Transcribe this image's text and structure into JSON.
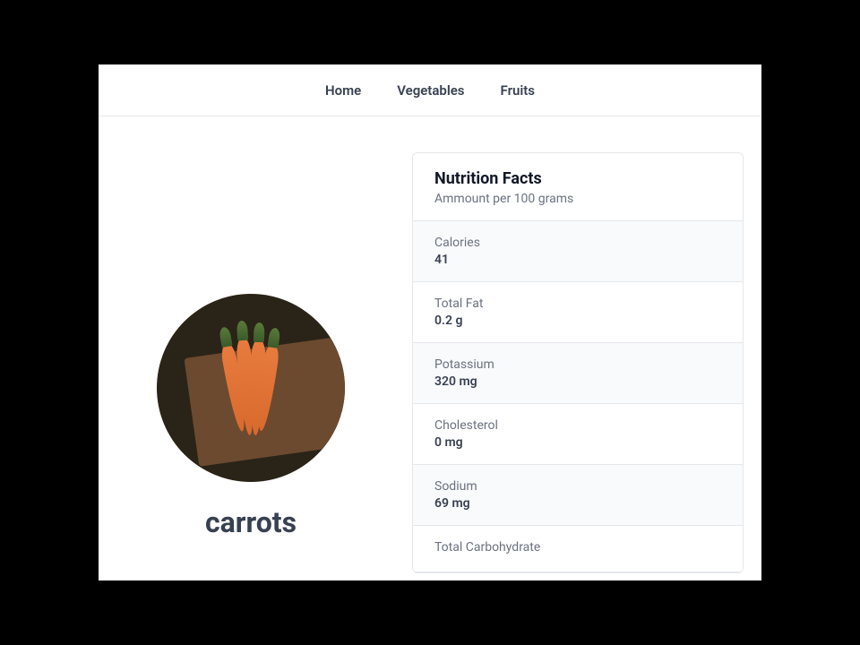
{
  "nav": {
    "home": "Home",
    "vegetables": "Vegetables",
    "fruits": "Fruits"
  },
  "food": {
    "name": "carrots"
  },
  "facts": {
    "title": "Nutrition Facts",
    "subtitle": "Ammount per 100 grams",
    "rows": [
      {
        "label": "Calories",
        "value": "41"
      },
      {
        "label": "Total Fat",
        "value": "0.2 g"
      },
      {
        "label": "Potassium",
        "value": "320 mg"
      },
      {
        "label": "Cholesterol",
        "value": "0 mg"
      },
      {
        "label": "Sodium",
        "value": "69 mg"
      },
      {
        "label": "Total Carbohydrate",
        "value": ""
      }
    ]
  }
}
